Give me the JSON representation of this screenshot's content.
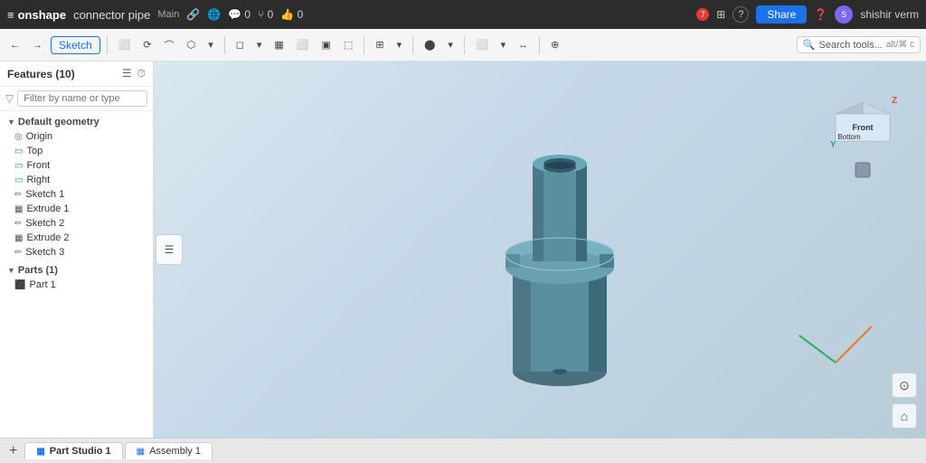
{
  "app": {
    "logo": "onshape",
    "hamburger": "≡",
    "title": "connector pipe",
    "tag": "Main",
    "link_icon": "🔗"
  },
  "topbar": {
    "comment_count": "0",
    "branch_count": "0",
    "like_count": "0",
    "share_label": "Share",
    "notification_count": "7",
    "help_icon": "?",
    "user_name": "shishir verm"
  },
  "toolbar": {
    "undo_label": "←",
    "redo_label": "→",
    "sketch_label": "Sketch",
    "search_placeholder": "Search tools...",
    "search_shortcut": "alt/⌘ c"
  },
  "sidebar": {
    "header": "Features (10)",
    "filter_placeholder": "Filter by name or type",
    "sections": [
      {
        "name": "Default geometry",
        "expanded": true,
        "items": [
          {
            "label": "Origin",
            "type": "origin"
          },
          {
            "label": "Top",
            "type": "plane"
          },
          {
            "label": "Front",
            "type": "plane"
          },
          {
            "label": "Right",
            "type": "plane"
          }
        ]
      }
    ],
    "features": [
      {
        "label": "Sketch 1",
        "type": "sketch"
      },
      {
        "label": "Extrude 1",
        "type": "extrude"
      },
      {
        "label": "Sketch 2",
        "type": "sketch"
      },
      {
        "label": "Extrude 2",
        "type": "extrude"
      },
      {
        "label": "Sketch 3",
        "type": "sketch"
      }
    ],
    "parts_section": "Parts (1)",
    "parts": [
      {
        "label": "Part 1",
        "type": "part"
      }
    ]
  },
  "orientation": {
    "front_label": "Front",
    "bottom_label": "Bottom",
    "z_axis": "Z",
    "y_axis": "Y"
  },
  "bottom_tabs": [
    {
      "label": "Part Studio 1",
      "active": true,
      "icon": "▦"
    },
    {
      "label": "Assembly 1",
      "active": false,
      "icon": "▦"
    }
  ],
  "colors": {
    "accent": "#1a73e8",
    "share_btn": "#1a73e8",
    "pipe_body": "#5a8fa0",
    "pipe_top": "#4a7f90",
    "pipe_collar": "#7ab0c0",
    "viewport_bg1": "#d4e8f0",
    "viewport_bg2": "#c0d4e4"
  }
}
